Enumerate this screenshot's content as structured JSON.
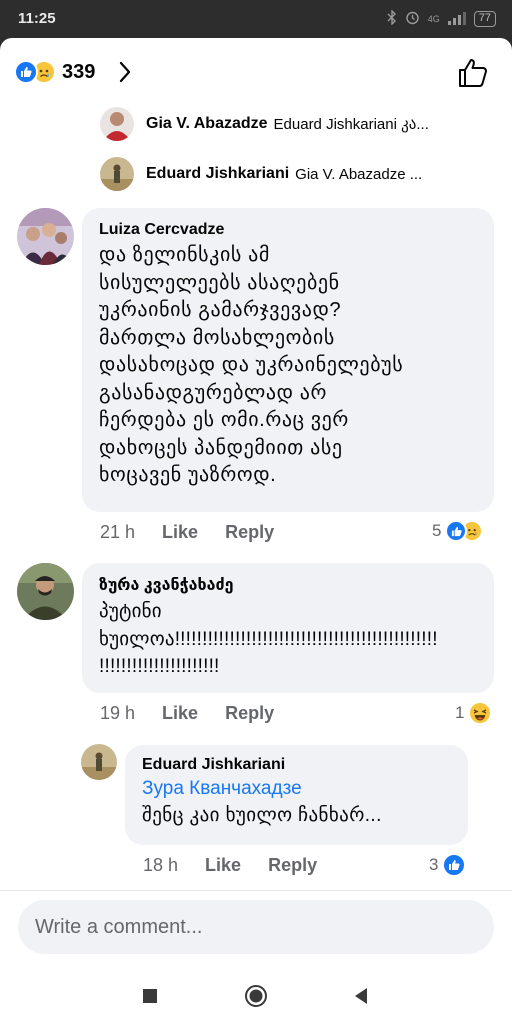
{
  "status": {
    "time": "11:25",
    "battery": "77",
    "network": "4G"
  },
  "header": {
    "reaction_count": "339",
    "reactions": [
      "like-icon",
      "sad-icon"
    ]
  },
  "reply_previews": [
    {
      "name": "Gia V. Abazadze",
      "text": "Eduard Jishkariani კა..."
    },
    {
      "name": "Eduard Jishkariani",
      "text": "Gia V. Abazadze ..."
    }
  ],
  "comments": [
    {
      "name": "Luiza Cercvadze",
      "text": "და ზელინსკის ამ\nსისულელეებს ასაღებენ\nუკრაინის გამარჯვევად?\nმართლა მოსახლეობის\nდასახოცად და უკრაინელებუს\nგასანადგურებლად არ\nჩერდება ეს ომი.რაც ვერ\nდახოცეს პანდემიით ასე\nხოცავენ უაზროდ.",
      "time": "21 h",
      "like_label": "Like",
      "reply_label": "Reply",
      "reaction_count": "5"
    },
    {
      "name": "ზურა კვანჭახაძე",
      "text": "პუტინი\nხუილოა!!!!!!!!!!!!!!!!!!!!!!!!!!!!!!!!!!!!!!!!!!!!!!!!\n!!!!!!!!!!!!!!!!!!!!!!",
      "time": "19 h",
      "like_label": "Like",
      "reply_label": "Reply",
      "reaction_count": "1"
    },
    {
      "name": "Eduard Jishkariani",
      "tag": "Зура Кванчахадзе",
      "text": "შენც კაი ხუილო ჩანხარ...",
      "time": "18 h",
      "like_label": "Like",
      "reply_label": "Reply",
      "reaction_count": "3"
    }
  ],
  "composer": {
    "placeholder": "Write a comment..."
  },
  "colors": {
    "accent": "#1877f2",
    "bubble": "#f0f2f5",
    "meta": "#65676b",
    "reaction_yellow": "#f7c53b"
  }
}
